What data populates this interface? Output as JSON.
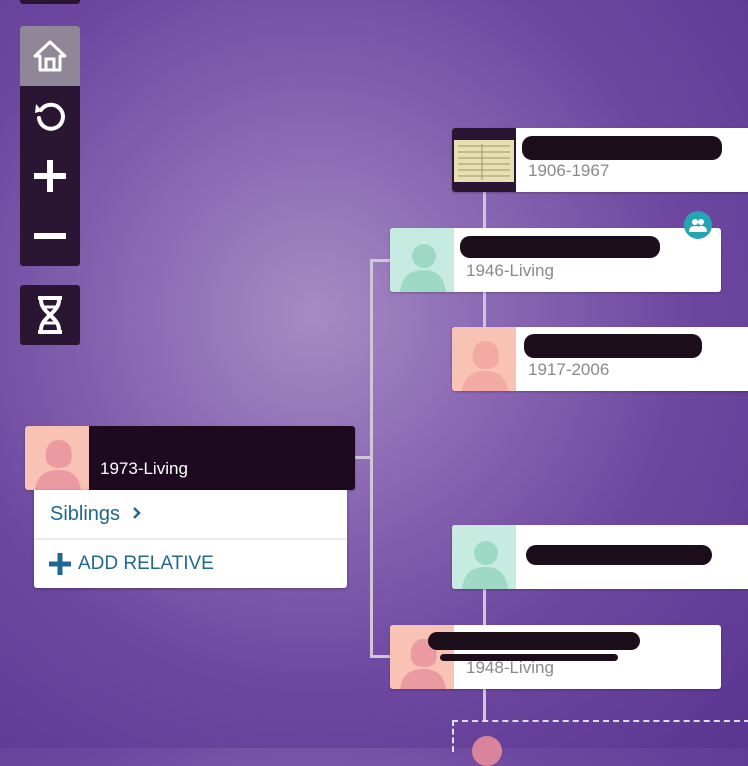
{
  "toolbar": {
    "buttons": [
      {
        "name": "home",
        "icon": "home-icon"
      },
      {
        "name": "refresh",
        "icon": "refresh-icon"
      },
      {
        "name": "zoom-in",
        "icon": "plus-icon"
      },
      {
        "name": "zoom-out",
        "icon": "minus-icon"
      }
    ],
    "dna_icon": "dna-icon"
  },
  "people": {
    "self": {
      "name": "",
      "dates": "1973-Living"
    },
    "father": {
      "name": "",
      "dates": "1946-Living"
    },
    "paternal_grandfather": {
      "name": "",
      "dates": "1906-1967"
    },
    "paternal_grandmother": {
      "name": "",
      "dates": "1917-2006"
    },
    "maternal_grandfather": {
      "name": "",
      "dates": ""
    },
    "mother": {
      "name": "",
      "dates": "1948-Living"
    }
  },
  "menu": {
    "siblings_label": "Siblings",
    "add_relative_label": "ADD RELATIVE"
  },
  "colors": {
    "female_portrait_bg": "#f8c3b5",
    "female_silhouette": "#ec9aa1",
    "male_portrait_bg": "#c7ebe1",
    "male_silhouette": "#9dd9c5",
    "badge": "#25a4b3",
    "link": "#20688f"
  }
}
